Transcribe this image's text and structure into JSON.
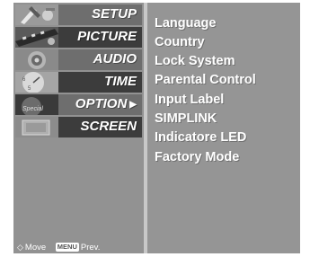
{
  "menu": {
    "tabs": [
      {
        "label": "SETUP",
        "icon": "tools-icon",
        "bar_color": "#6e6e6e"
      },
      {
        "label": "PICTURE",
        "icon": "film-icon",
        "bar_color": "#3c3c3c"
      },
      {
        "label": "AUDIO",
        "icon": "speaker-icon",
        "bar_color": "#6e6e6e"
      },
      {
        "label": "TIME",
        "icon": "clock-icon",
        "bar_color": "#3c3c3c"
      },
      {
        "label": "OPTION",
        "icon": "option-icon",
        "bar_color": "#6e6e6e",
        "selected": true,
        "arrow": "▶"
      },
      {
        "label": "SCREEN",
        "icon": "screen-icon",
        "bar_color": "#3c3c3c"
      }
    ],
    "items": [
      "Language",
      "Country",
      "Lock System",
      "Parental Control",
      "Input Label",
      "SIMPLINK",
      "Indicatore LED",
      "Factory Mode"
    ]
  },
  "footer": {
    "move_label": "Move",
    "menu_key": "MENU",
    "prev_label": "Prev."
  },
  "colors": {
    "panel": "#929292",
    "highlight_bar": "#6e6e6e",
    "dark_bar": "#3c3c3c",
    "text": "#ffffff"
  }
}
